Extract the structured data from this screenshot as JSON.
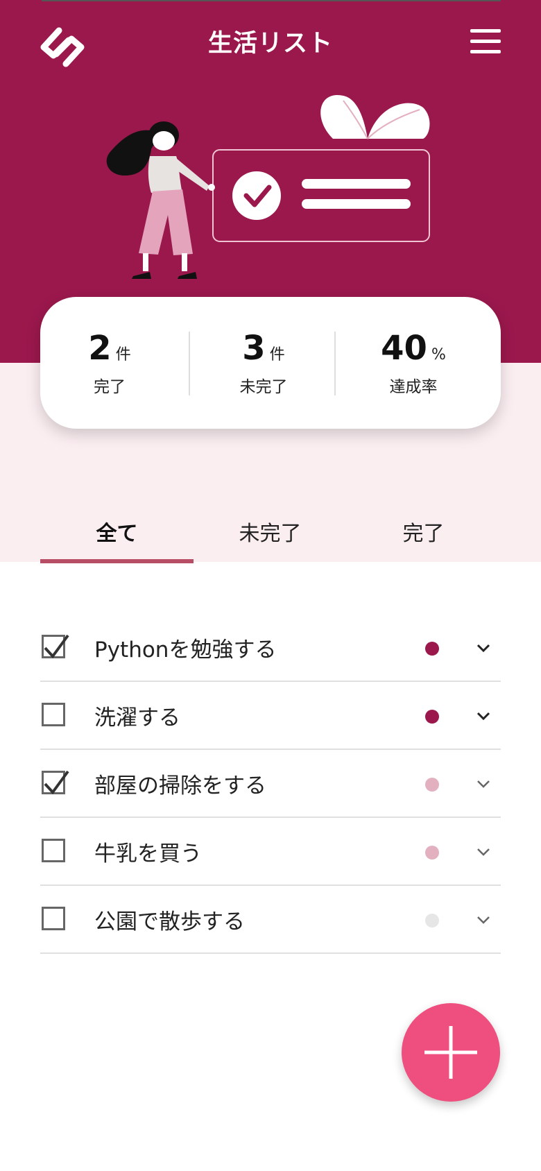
{
  "header": {
    "title": "生活リスト"
  },
  "stats": [
    {
      "value": "2",
      "unit": "件",
      "label": "完了"
    },
    {
      "value": "3",
      "unit": "件",
      "label": "未完了"
    },
    {
      "value": "40",
      "unit": "%",
      "label": "達成率"
    }
  ],
  "tabs": [
    {
      "label": "全て",
      "active": true
    },
    {
      "label": "未完了",
      "active": false
    },
    {
      "label": "完了",
      "active": false
    }
  ],
  "tasks": [
    {
      "label": "Pythonを勉強する",
      "checked": true,
      "priority_color": "#9b184d"
    },
    {
      "label": "洗濯する",
      "checked": false,
      "priority_color": "#9b184d"
    },
    {
      "label": "部屋の掃除をする",
      "checked": true,
      "priority_color": "#e3b0c0"
    },
    {
      "label": "牛乳を買う",
      "checked": false,
      "priority_color": "#e3b0c0"
    },
    {
      "label": "公園で散歩する",
      "checked": false,
      "priority_color": "#e6e6e6"
    }
  ],
  "icons": {
    "logo": "app-logo-icon",
    "menu": "hamburger-menu-icon",
    "checkbox": "checkmark-icon",
    "expand": "chevron-down-icon",
    "add": "plus-icon"
  },
  "colors": {
    "header_bg": "#9b184d",
    "band_bg": "#fbeef1",
    "tab_underline": "#b84d66",
    "fab": "#ef4f7f"
  }
}
